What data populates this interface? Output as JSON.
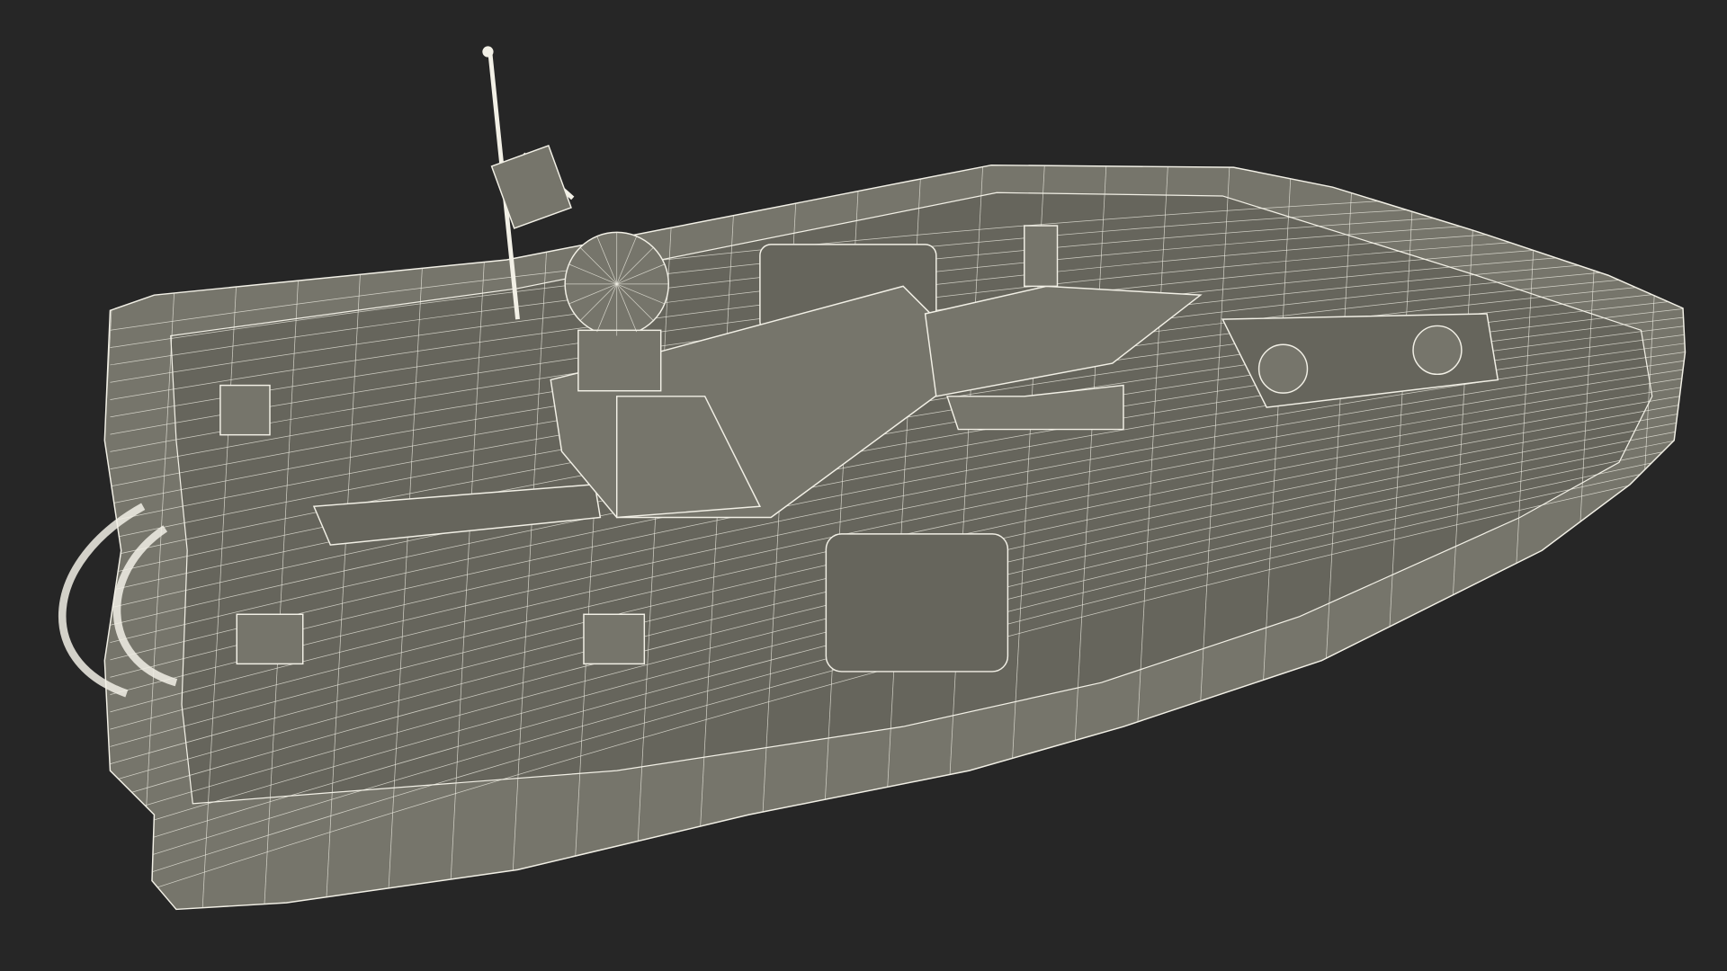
{
  "scene": {
    "subject": "boat-wireframe-render",
    "background_color": "#262626",
    "surface_color": "#76756b",
    "surface_dark": "#66655c",
    "wire_color": "#f2f0e6"
  }
}
